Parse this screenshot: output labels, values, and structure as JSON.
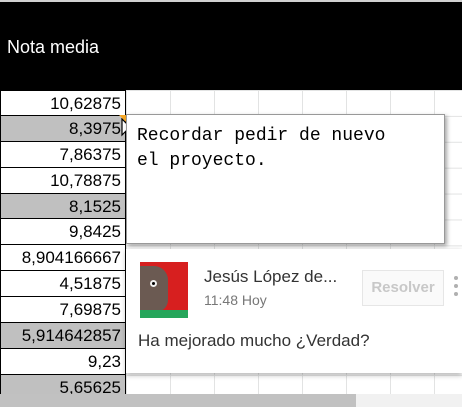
{
  "header": {
    "column_title": "Nota media"
  },
  "cells": [
    {
      "value": "10,62875",
      "selected": false
    },
    {
      "value": "8,3975",
      "selected": true
    },
    {
      "value": "7,86375",
      "selected": false
    },
    {
      "value": "10,78875",
      "selected": false
    },
    {
      "value": "8,1525",
      "selected": true
    },
    {
      "value": "9,8425",
      "selected": false
    },
    {
      "value": "8,904166667",
      "selected": false
    },
    {
      "value": "4,51875",
      "selected": false
    },
    {
      "value": "7,69875",
      "selected": false
    },
    {
      "value": "5,914642857",
      "selected": true
    },
    {
      "value": "9,23",
      "selected": false
    },
    {
      "value": "5,65625",
      "selected": true
    }
  ],
  "note": {
    "line1": "Recordar pedir de nuevo",
    "line2": "el proyecto."
  },
  "comment": {
    "author": "Jesús López de...",
    "time": "11:48 Hoy",
    "resolve_label": "Resolver",
    "text": "Ha mejorado mucho ¿Verdad?"
  },
  "colors": {
    "header_bg": "#000000",
    "selected_cell": "#c0c0c0",
    "note_marker": "#f5a623",
    "avatar_red": "#d71f1f",
    "avatar_green": "#26a65b"
  },
  "icons": {
    "more": "more-vert-icon",
    "cursor": "mouse-pointer-icon"
  }
}
